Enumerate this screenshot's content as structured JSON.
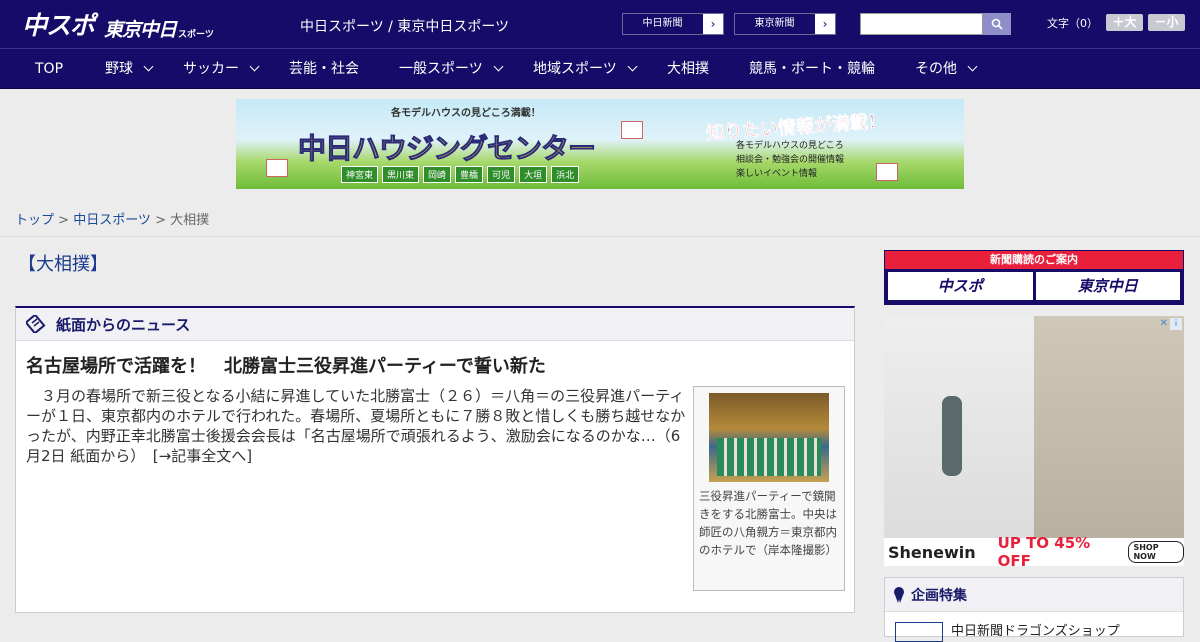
{
  "header": {
    "logo_main": "中スポ",
    "logo_sub": "東京中日",
    "logo_small": "スポーツ",
    "site_title": "中日スポーツ / 東京中日スポーツ",
    "paper_links": [
      "中日新聞",
      "東京新聞"
    ],
    "search_placeholder": "",
    "font_size_label": "文字（0）",
    "font_bigger": "＋大",
    "font_smaller": "－小"
  },
  "nav": [
    {
      "label": "TOP",
      "has_menu": false
    },
    {
      "label": "野球",
      "has_menu": true
    },
    {
      "label": "サッカー",
      "has_menu": true
    },
    {
      "label": "芸能・社会",
      "has_menu": false
    },
    {
      "label": "一般スポーツ",
      "has_menu": true
    },
    {
      "label": "地域スポーツ",
      "has_menu": true
    },
    {
      "label": "大相撲",
      "has_menu": false
    },
    {
      "label": "競馬・ボート・競輪",
      "has_menu": false
    },
    {
      "label": "その他",
      "has_menu": true
    }
  ],
  "banner": {
    "top_text": "各モデルハウスの見どころ満載！",
    "main_text": "中日ハウジングセンター",
    "right_text": "知りたい情報が満載！",
    "list": [
      "各モデルハウスの見どころ",
      "相談会・勉強会の開催情報",
      "楽しいイベント情報"
    ],
    "places": [
      "神宮東",
      "黒川東",
      "岡崎",
      "豊橋",
      "可児",
      "大垣",
      "浜北"
    ]
  },
  "breadcrumb": {
    "top": "トップ",
    "sep1": " > ",
    "section": "中日スポーツ",
    "sep2": " > ",
    "current": "大相撲"
  },
  "main": {
    "page_title": "【大相撲】",
    "news_header": "紙面からのニュース",
    "article": {
      "title": "名古屋場所で活躍を！　北勝富士三役昇進パーティーで誓い新た",
      "body": "３月の春場所で新三役となる小結に昇進していた北勝富士（２６）＝八角＝の三役昇進パーティーが１日、東京都内のホテルで行われた。春場所、夏場所ともに７勝８敗と惜しくも勝ち越せなかったが、内野正幸北勝富士後援会会長は「名古屋場所で頑張れるよう、激励会になるのかな…（6月2日 紙面から）　[→記事全文へ]",
      "caption": "三役昇進パーティーで鏡開きをする北勝富士。中央は師匠の八角親方＝東京都内のホテルで（岸本隆撮影）"
    }
  },
  "sidebar": {
    "subscribe_header": "新聞購読のご案内",
    "subscribe_buttons": [
      "中スポ",
      "東京中日"
    ],
    "ad": {
      "brand": "Shenewin",
      "sale": "UP TO 45% OFF",
      "cta": "SHOP NOW"
    },
    "feature_header": "企画特集",
    "feature_item": "中日新聞ドラゴンズショップ"
  }
}
